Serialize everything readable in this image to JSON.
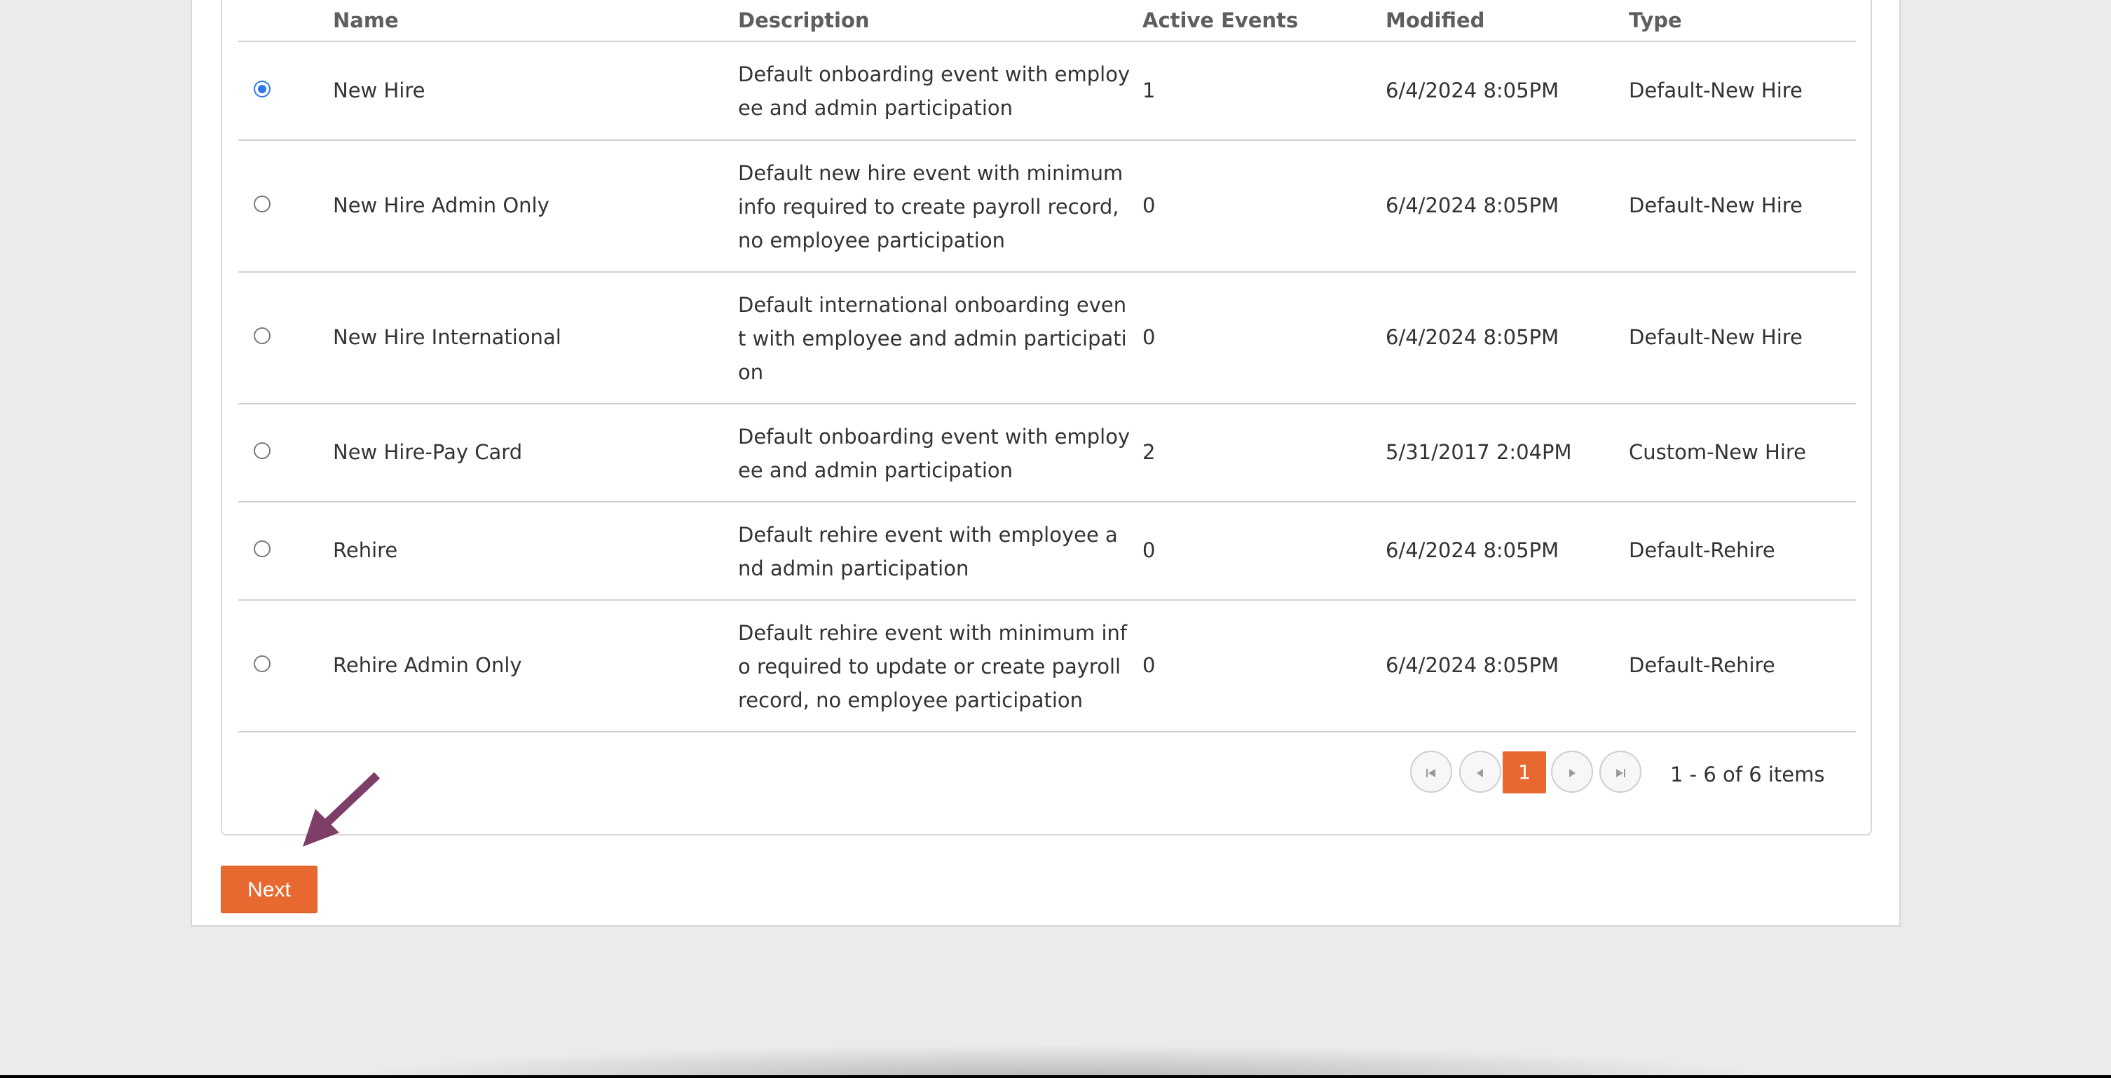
{
  "table": {
    "columns": {
      "name": "Name",
      "description": "Description",
      "active_events": "Active Events",
      "modified": "Modified",
      "type": "Type"
    },
    "rows": [
      {
        "selected": true,
        "name": "New Hire",
        "description": "Default onboarding event with employee and admin participation",
        "active_events": "1",
        "modified": "6/4/2024 8:05PM",
        "type": "Default-New Hire"
      },
      {
        "selected": false,
        "name": "New Hire Admin Only",
        "description": "Default new hire event with minimum info required to create payroll record, no employee participation",
        "active_events": "0",
        "modified": "6/4/2024 8:05PM",
        "type": "Default-New Hire"
      },
      {
        "selected": false,
        "name": "New Hire International",
        "description": "Default international onboarding event with employee and admin participation",
        "active_events": "0",
        "modified": "6/4/2024 8:05PM",
        "type": "Default-New Hire"
      },
      {
        "selected": false,
        "name": "New Hire-Pay Card",
        "description": "Default onboarding event with employee and admin participation",
        "active_events": "2",
        "modified": "5/31/2017 2:04PM",
        "type": "Custom-New Hire"
      },
      {
        "selected": false,
        "name": "Rehire",
        "description": "Default rehire event with employee and admin participation",
        "active_events": "0",
        "modified": "6/4/2024 8:05PM",
        "type": "Default-Rehire"
      },
      {
        "selected": false,
        "name": "Rehire Admin Only",
        "description": "Default rehire event with minimum info required to update or create payroll record, no employee participation",
        "active_events": "0",
        "modified": "6/4/2024 8:05PM",
        "type": "Default-Rehire"
      }
    ]
  },
  "pager": {
    "first_icon": "first-page-icon",
    "prev_icon": "previous-page-icon",
    "next_icon": "next-page-icon",
    "last_icon": "last-page-icon",
    "current_page": "1",
    "info": "1 - 6 of 6 items"
  },
  "actions": {
    "next_label": "Next"
  },
  "annotation": {
    "arrow_icon": "pointer-arrow-icon",
    "arrow_color": "#7d3f67"
  },
  "colors": {
    "accent": "#e8692f",
    "radio_selected": "#2f7be5"
  }
}
